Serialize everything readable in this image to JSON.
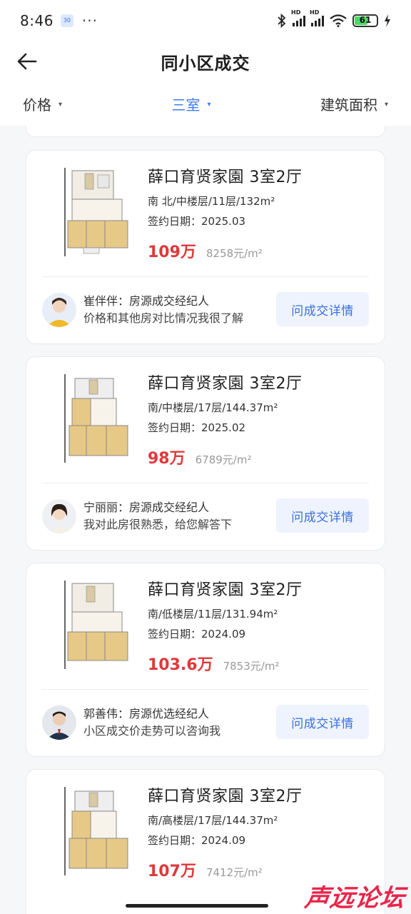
{
  "status": {
    "time": "8:46",
    "badge": "30",
    "battery": "61"
  },
  "nav": {
    "title": "同小区成交"
  },
  "filters": [
    {
      "label": "价格",
      "active": false
    },
    {
      "label": "三室",
      "active": true
    },
    {
      "label": "建筑面积",
      "active": false
    }
  ],
  "cards": [
    {
      "name": "薛口育贤家園 3室2厅",
      "meta": "南 北/中楼层/11层/132m²",
      "date": "签约日期：2025.03",
      "price": "109万",
      "unit_price": "8258元/m²",
      "agent_line1": "崔伴伴：房源成交经纪人",
      "agent_line2": "价格和其他房对比情况我很了解",
      "button": "问成交详情"
    },
    {
      "name": "薛口育贤家園 3室2厅",
      "meta": "南/中楼层/17层/144.37m²",
      "date": "签约日期：2025.02",
      "price": "98万",
      "unit_price": "6789元/m²",
      "agent_line1": "宁丽丽：房源成交经纪人",
      "agent_line2": "我对此房很熟悉，给您解答下",
      "button": "问成交详情"
    },
    {
      "name": "薛口育贤家園 3室2厅",
      "meta": "南/低楼层/11层/131.94m²",
      "date": "签约日期：2024.09",
      "price": "103.6万",
      "unit_price": "7853元/m²",
      "agent_line1": "郭善伟：房源优选经纪人",
      "agent_line2": "小区成交价走势可以咨询我",
      "button": "问成交详情"
    },
    {
      "name": "薛口育贤家園 3室2厅",
      "meta": "南/高楼层/17层/144.37m²",
      "date": "签约日期：2024.09",
      "price": "107万",
      "unit_price": "7412元/m²"
    }
  ],
  "watermark": "声远论坛",
  "colors": {
    "accent": "#3e7bea",
    "price": "#e0383b"
  }
}
